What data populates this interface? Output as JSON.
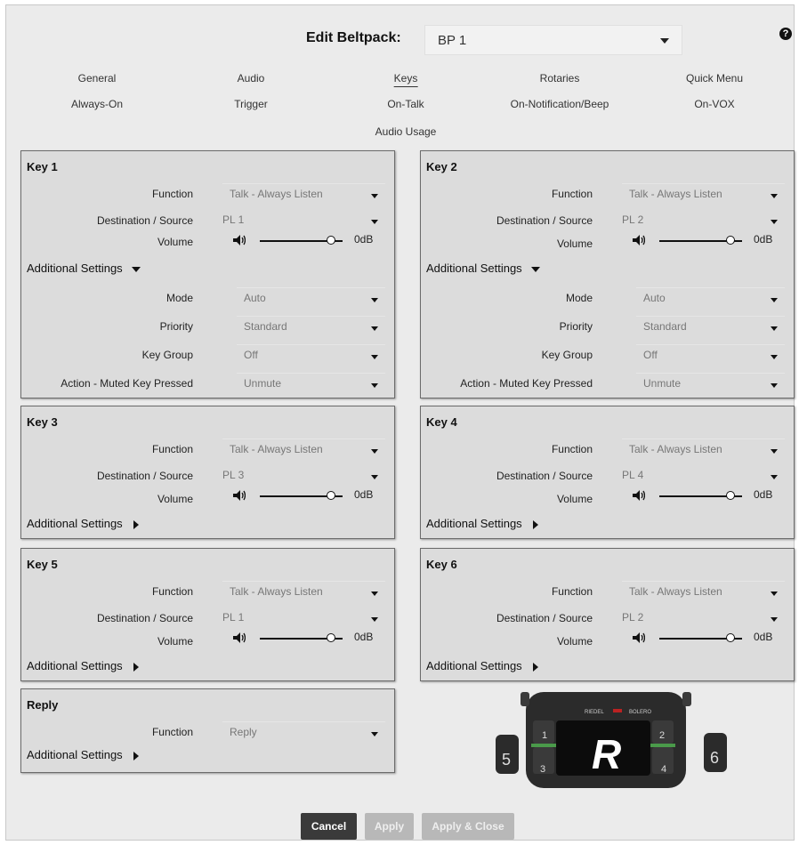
{
  "header": {
    "label": "Edit Beltpack:",
    "beltpack_value": "BP 1",
    "help_glyph": "?"
  },
  "tabs": [
    {
      "label": "General",
      "active": false
    },
    {
      "label": "Audio",
      "active": false
    },
    {
      "label": "Keys",
      "active": true
    },
    {
      "label": "Rotaries",
      "active": false
    },
    {
      "label": "Quick Menu",
      "active": false
    },
    {
      "label": "Always-On",
      "active": false
    },
    {
      "label": "Trigger",
      "active": false
    },
    {
      "label": "On-Talk",
      "active": false
    },
    {
      "label": "On-Notification/Beep",
      "active": false
    },
    {
      "label": "On-VOX",
      "active": false
    },
    {
      "label": "Audio Usage",
      "active": false
    }
  ],
  "labels": {
    "function": "Function",
    "destination": "Destination / Source",
    "volume": "Volume",
    "additional": "Additional Settings",
    "mode": "Mode",
    "priority": "Priority",
    "key_group": "Key Group",
    "action_muted": "Action - Muted Key Pressed"
  },
  "keys": [
    {
      "title": "Key 1",
      "function": "Talk - Always Listen",
      "destination": "PL 1",
      "volume": "0dB",
      "volume_level": 0.86,
      "expanded": true,
      "mode": "Auto",
      "priority": "Standard",
      "key_group": "Off",
      "action_muted": "Unmute"
    },
    {
      "title": "Key 2",
      "function": "Talk - Always Listen",
      "destination": "PL 2",
      "volume": "0dB",
      "volume_level": 0.86,
      "expanded": true,
      "mode": "Auto",
      "priority": "Standard",
      "key_group": "Off",
      "action_muted": "Unmute"
    },
    {
      "title": "Key 3",
      "function": "Talk - Always Listen",
      "destination": "PL 3",
      "volume": "0dB",
      "volume_level": 0.86,
      "expanded": false
    },
    {
      "title": "Key 4",
      "function": "Talk - Always Listen",
      "destination": "PL 4",
      "volume": "0dB",
      "volume_level": 0.86,
      "expanded": false
    },
    {
      "title": "Key 5",
      "function": "Talk - Always Listen",
      "destination": "PL 1",
      "volume": "0dB",
      "volume_level": 0.86,
      "expanded": false
    },
    {
      "title": "Key 6",
      "function": "Talk - Always Listen",
      "destination": "PL 2",
      "volume": "0dB",
      "volume_level": 0.86,
      "expanded": false
    }
  ],
  "reply": {
    "title": "Reply",
    "function": "Reply",
    "expanded": false
  },
  "device": {
    "brand": "RIEDEL",
    "model": "BOLERO",
    "logo_letter": "R",
    "key_numbers": [
      "1",
      "2",
      "3",
      "4",
      "5",
      "6"
    ]
  },
  "buttons": {
    "cancel": "Cancel",
    "apply": "Apply",
    "apply_close": "Apply & Close"
  },
  "colors": {
    "panel_bg": "#dcdcdc",
    "page_bg": "#ebebeb",
    "cancel_bg": "#3a3a3a",
    "disabled_bg": "#b8b8b8",
    "device_body": "#2b2b2b",
    "device_green": "#4a9a4a"
  }
}
